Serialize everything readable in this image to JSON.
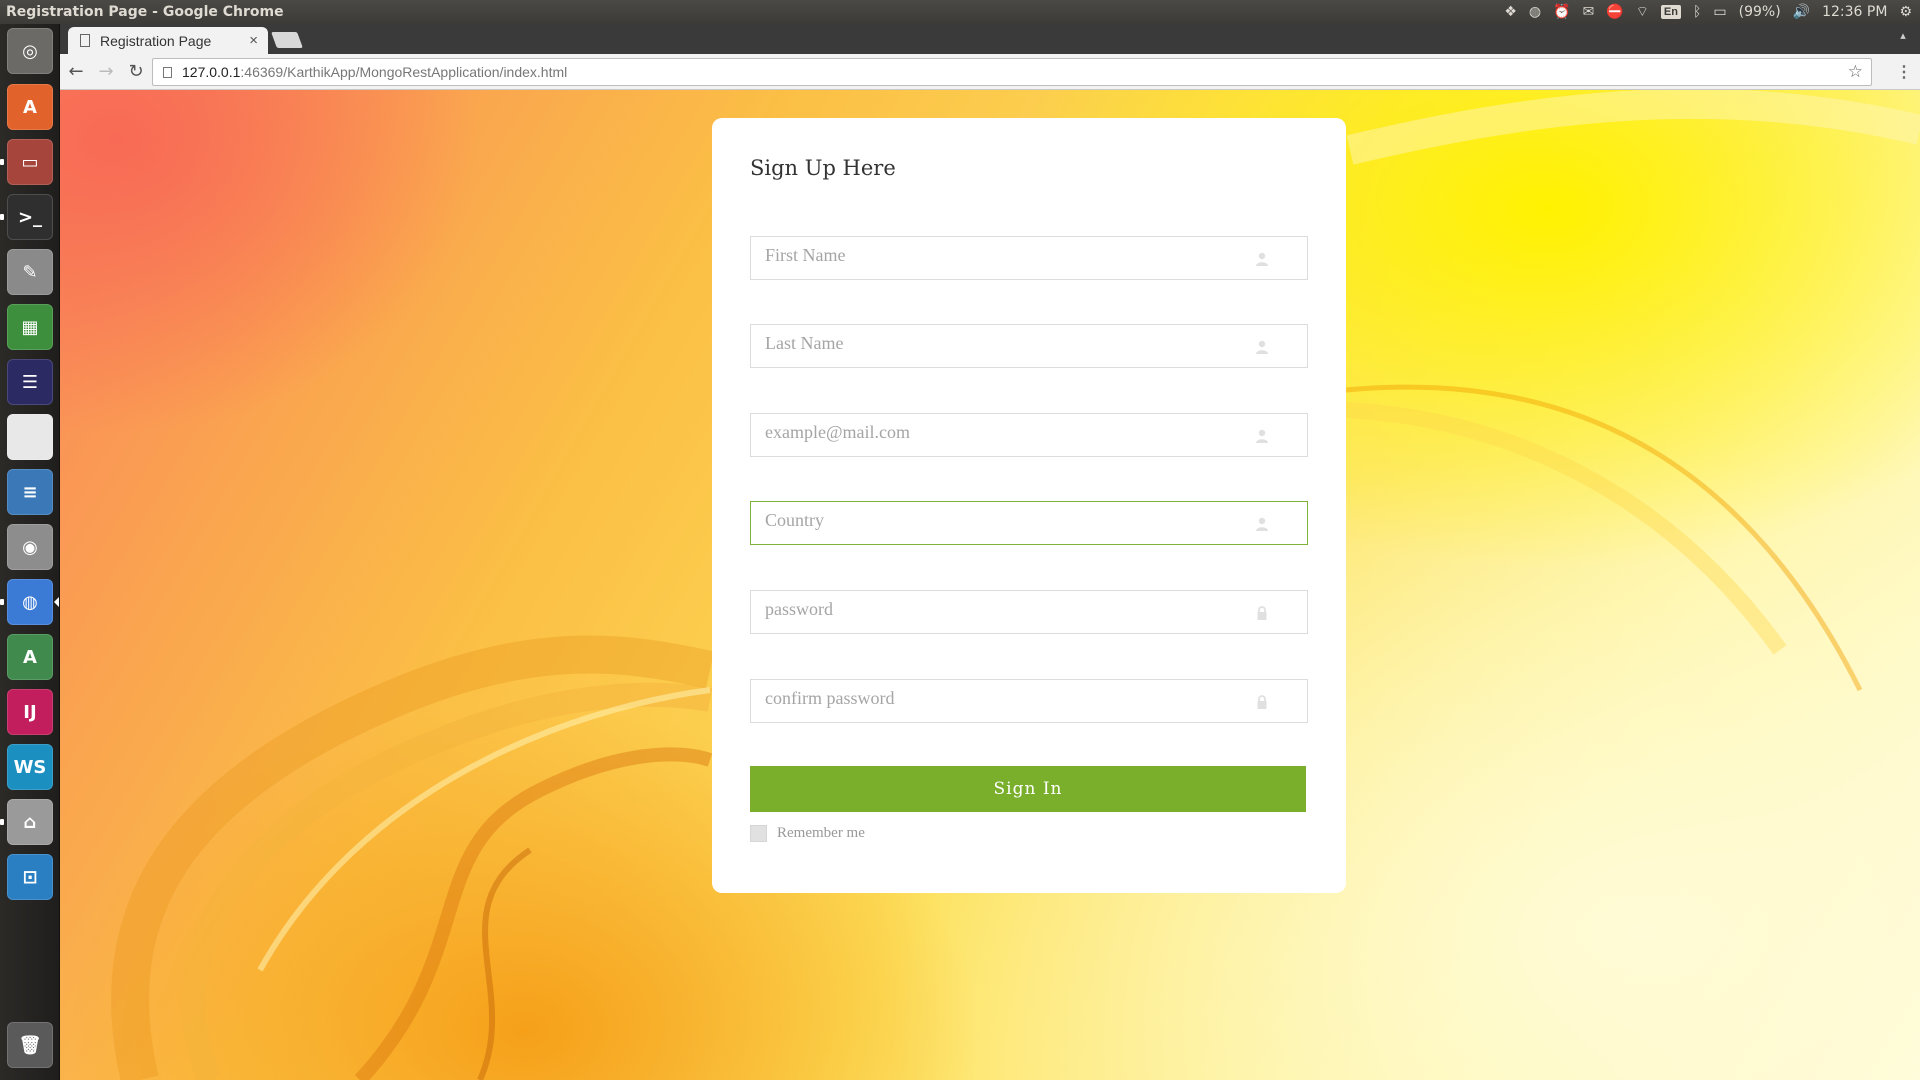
{
  "window": {
    "title": "Registration Page - Google Chrome"
  },
  "tray": {
    "keyboard_layout": "En",
    "battery": "(99%)",
    "clock": "12:36 PM"
  },
  "browser": {
    "tab_title": "Registration Page",
    "tab_close": "×",
    "url_host": "127.0.0.1",
    "url_path": ":46369/KarthikApp/MongoRestApplication/index.html"
  },
  "launcher": {
    "items": [
      {
        "name": "dash-home-icon",
        "glyph": "◎",
        "color": "#6b6a66"
      },
      {
        "name": "software-center-icon",
        "glyph": "A",
        "color": "#e2622b"
      },
      {
        "name": "files-icon",
        "glyph": "▭",
        "color": "#a6453b"
      },
      {
        "name": "terminal-icon",
        "glyph": ">_",
        "color": "#2f2f2f"
      },
      {
        "name": "text-editor-icon",
        "glyph": "✎",
        "color": "#8a8a8a"
      },
      {
        "name": "spreadsheet-icon",
        "glyph": "▦",
        "color": "#3d8f3d"
      },
      {
        "name": "eclipse-icon",
        "glyph": "☰",
        "color": "#2c2a63"
      },
      {
        "name": "blank-document-icon",
        "glyph": "",
        "color": "#e8e8e8"
      },
      {
        "name": "writer-icon",
        "glyph": "≡",
        "color": "#3a78b8"
      },
      {
        "name": "screenshot-icon",
        "glyph": "◉",
        "color": "#8d8d8d"
      },
      {
        "name": "chrome-icon",
        "glyph": "◍",
        "color": "#3b7bd6"
      },
      {
        "name": "android-studio-icon",
        "glyph": "A",
        "color": "#3f8a4c"
      },
      {
        "name": "intellij-icon",
        "glyph": "IJ",
        "color": "#c21d5c"
      },
      {
        "name": "webstorm-icon",
        "glyph": "WS",
        "color": "#1a8fc0"
      },
      {
        "name": "scanner-icon",
        "glyph": "⌂",
        "color": "#9a9a9a"
      },
      {
        "name": "workspace-icon",
        "glyph": "⊡",
        "color": "#2a7fc2"
      }
    ],
    "trash": {
      "name": "trash-icon",
      "glyph": "🗑",
      "color": "#5a5a5a"
    }
  },
  "form": {
    "title": "Sign Up Here",
    "fields": [
      {
        "placeholder": "First Name",
        "icon": "user-icon"
      },
      {
        "placeholder": "Last Name",
        "icon": "user-icon"
      },
      {
        "placeholder": "example@mail.com",
        "icon": "user-icon"
      },
      {
        "placeholder": "Country",
        "icon": "user-icon",
        "focused": true
      },
      {
        "placeholder": "password",
        "icon": "lock-icon"
      },
      {
        "placeholder": "confirm password",
        "icon": "lock-icon"
      }
    ],
    "submit_label": "Sign In",
    "remember_label": "Remember me",
    "accent_color": "#7aaf2c"
  }
}
